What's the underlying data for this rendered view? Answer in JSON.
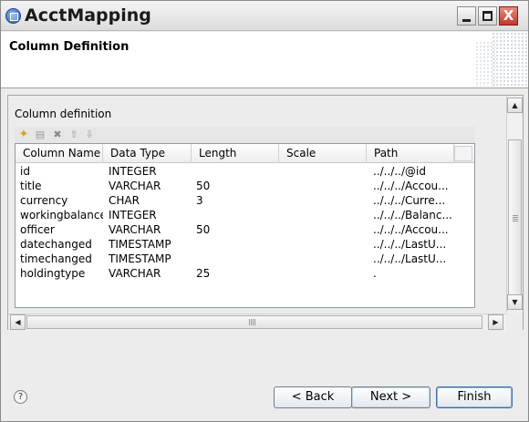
{
  "window": {
    "title": "AcctMapping",
    "minimize_label": "",
    "maximize_label": "",
    "close_label": "X"
  },
  "banner": {
    "title": "Column Definition"
  },
  "section": {
    "label": "Column definition"
  },
  "toolbar": {
    "icons": [
      "add-icon",
      "edit-icon",
      "delete-icon",
      "move-up-icon",
      "move-down-icon"
    ],
    "add_glyph": "✦",
    "edit_glyph": "▤",
    "delete_glyph": "✖",
    "up_glyph": "⇧",
    "down_glyph": "⇩"
  },
  "table": {
    "columns": [
      "Column Name",
      "Data Type",
      "Length",
      "Scale",
      "Path"
    ],
    "rows": [
      {
        "name": "id",
        "type": "INTEGER",
        "length": "",
        "scale": "",
        "path": "../../../@id"
      },
      {
        "name": "title",
        "type": "VARCHAR",
        "length": "50",
        "scale": "",
        "path": "../../../Accou..."
      },
      {
        "name": "currency",
        "type": "CHAR",
        "length": "3",
        "scale": "",
        "path": "../../../Curre..."
      },
      {
        "name": "workingbalance",
        "type": "INTEGER",
        "length": "",
        "scale": "",
        "path": "../../../Balanc..."
      },
      {
        "name": "officer",
        "type": "VARCHAR",
        "length": "50",
        "scale": "",
        "path": "../../../Accou..."
      },
      {
        "name": "datechanged",
        "type": "TIMESTAMP",
        "length": "",
        "scale": "",
        "path": "../../../LastU..."
      },
      {
        "name": "timechanged",
        "type": "TIMESTAMP",
        "length": "",
        "scale": "",
        "path": "../../../LastU..."
      },
      {
        "name": "holdingtype",
        "type": "VARCHAR",
        "length": "25",
        "scale": "",
        "path": "."
      }
    ]
  },
  "buttons": {
    "help": "?",
    "back": "< Back",
    "next": "Next >",
    "finish": "Finish"
  },
  "scroll": {
    "up": "▲",
    "down": "▼",
    "left": "◀",
    "right": "▶"
  }
}
